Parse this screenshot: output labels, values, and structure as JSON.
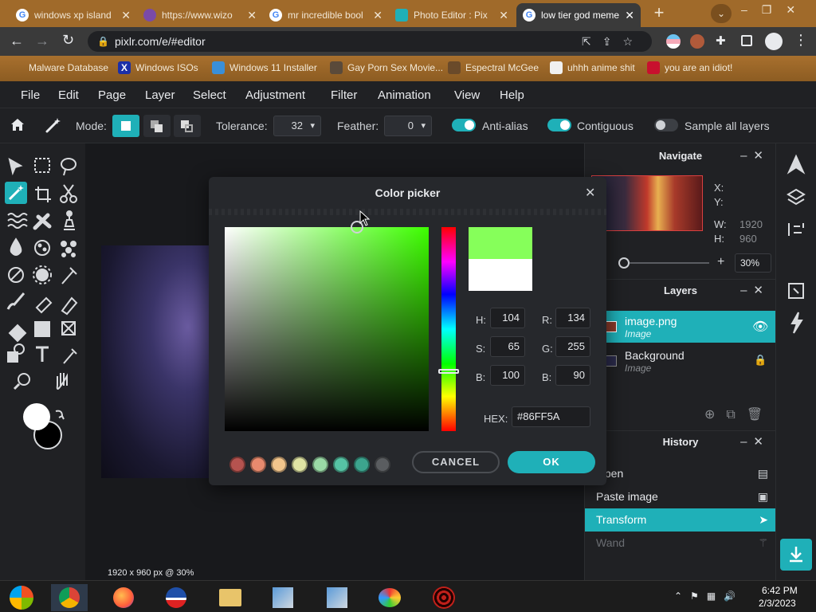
{
  "browser": {
    "tabs": [
      {
        "label": "windows xp island",
        "favicon": "google-icon"
      },
      {
        "label": "https://www.wizo",
        "favicon": "wizard-icon"
      },
      {
        "label": "mr incredible bool",
        "favicon": "google-icon"
      },
      {
        "label": "Photo Editor : Pix",
        "favicon": "pixlr-icon"
      },
      {
        "label": "low tier god meme",
        "favicon": "google-icon"
      }
    ],
    "url": "pixlr.com/e/#editor",
    "bookmarks": [
      "Malware Database",
      "Windows ISOs",
      "Windows 11 Installer",
      "Gay Porn Sex Movie...",
      "Espectral McGee",
      "uhhh anime shit",
      "you are an idiot!"
    ],
    "theme_color": "#a06a2a"
  },
  "menu": [
    "File",
    "Edit",
    "Page",
    "Layer",
    "Select",
    "Adjustment",
    "Filter",
    "Animation",
    "View",
    "Help"
  ],
  "tool_options": {
    "mode_label": "Mode:",
    "tolerance_label": "Tolerance:",
    "tolerance_value": "32",
    "feather_label": "Feather:",
    "feather_value": "0",
    "anti_alias_label": "Anti-alias",
    "contiguous_label": "Contiguous",
    "sample_all_label": "Sample all layers"
  },
  "canvas": {
    "status": "1920 x 960 px @ 30%"
  },
  "color_picker": {
    "title": "Color picker",
    "h_label": "H:",
    "h": "104",
    "s_label": "S:",
    "s": "65",
    "bv_label": "B:",
    "bv": "100",
    "r_label": "R:",
    "r": "134",
    "g_label": "G:",
    "g": "255",
    "b_label": "B:",
    "b": "90",
    "hex_label": "HEX:",
    "hex": "#86FF5A",
    "new_color": "#86ff5a",
    "old_color": "#ffffff",
    "swatches": [
      "#b5534f",
      "#e88a6e",
      "#f2c58c",
      "#dfe3a3",
      "#9ad9a6",
      "#56c2a4",
      "#3ca48e",
      "#5a5d60"
    ],
    "cancel_label": "CANCEL",
    "ok_label": "OK",
    "accent": "#1fb0b8"
  },
  "navigate": {
    "title": "Navigate",
    "x_label": "X:",
    "y_label": "Y:",
    "w_label": "W:",
    "w": "1920",
    "h_label": "H:",
    "h": "960",
    "zoom": "30%"
  },
  "layers": {
    "title": "Layers",
    "items": [
      {
        "name": "image.png",
        "type": "Image"
      },
      {
        "name": "Background",
        "type": "Image"
      }
    ]
  },
  "history": {
    "title": "History",
    "items": [
      "Open",
      "Paste image",
      "Transform",
      "Wand"
    ]
  },
  "taskbar": {
    "time": "6:42 PM",
    "date": "2/3/2023"
  }
}
